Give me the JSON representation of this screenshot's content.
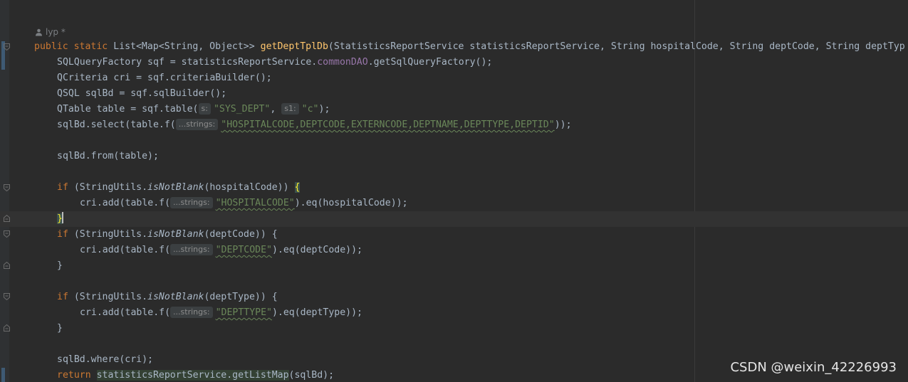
{
  "author_hint": {
    "icon": "person-icon",
    "text": "lyp *"
  },
  "code": {
    "method_decl": {
      "mod1": "public",
      "mod2": "static",
      "ret": "List<Map<String, Object>> ",
      "name": "getDeptTplDb",
      "params": "(StatisticsReportService statisticsReportService, String hospitalCode, String deptCode, String deptTyp"
    },
    "l_sqf": {
      "a": "SQLQueryFactory sqf = statisticsReportService.",
      "field": "commonDAO",
      "b": ".getSqlQueryFactory();"
    },
    "l_cri": "QCriteria cri = sqf.criteriaBuilder();",
    "l_sqlbd": "QSQL sqlBd = sqf.sqlBuilder();",
    "l_table": {
      "a": "QTable table = sqf.table(",
      "hint1": "s:",
      "str1": "\"SYS_DEPT\"",
      "sep": ", ",
      "hint2": "s1:",
      "str2": "\"c\"",
      "b": ");"
    },
    "l_select": {
      "a": "sqlBd.select(table.f(",
      "hint": "...strings:",
      "str": "\"HOSPITALCODE,DEPTCODE,EXTERNCODE,DEPTNAME,DEPTTYPE,DEPTID\"",
      "b": "));"
    },
    "l_from": "sqlBd.from(table);",
    "if1": {
      "kw": "if",
      "a": " (StringUtils.",
      "call": "isNotBlank",
      "b": "(hospitalCode)) ",
      "brace": "{"
    },
    "add1": {
      "a": "cri.add(table.f(",
      "hint": "...strings:",
      "str": "\"HOSPITALCODE\"",
      "b": ").eq(hospitalCode));"
    },
    "close1": "}",
    "if2": {
      "kw": "if",
      "a": " (StringUtils.",
      "call": "isNotBlank",
      "b": "(deptCode)) {"
    },
    "add2": {
      "a": "cri.add(table.f(",
      "hint": "...strings:",
      "str": "\"DEPTCODE\"",
      "b": ").eq(deptCode));"
    },
    "close2": "}",
    "if3": {
      "kw": "if",
      "a": " (StringUtils.",
      "call": "isNotBlank",
      "b": "(deptType)) {"
    },
    "add3": {
      "a": "cri.add(table.f(",
      "hint": "...strings:",
      "str": "\"DEPTTYPE\"",
      "b": ").eq(deptType));"
    },
    "close3": "}",
    "l_where": "sqlBd.where(cri);",
    "ret": {
      "kw": "return",
      "call": "statisticsReportService.getListMap",
      "b": "(sqlBd);"
    }
  },
  "watermark": "CSDN @weixin_42226993",
  "colors": {
    "background": "#2b2b2b",
    "keyword": "#cc7832",
    "method_name": "#ffc66d",
    "string": "#6a8759",
    "field": "#9876aa",
    "text": "#a9b7c6"
  }
}
